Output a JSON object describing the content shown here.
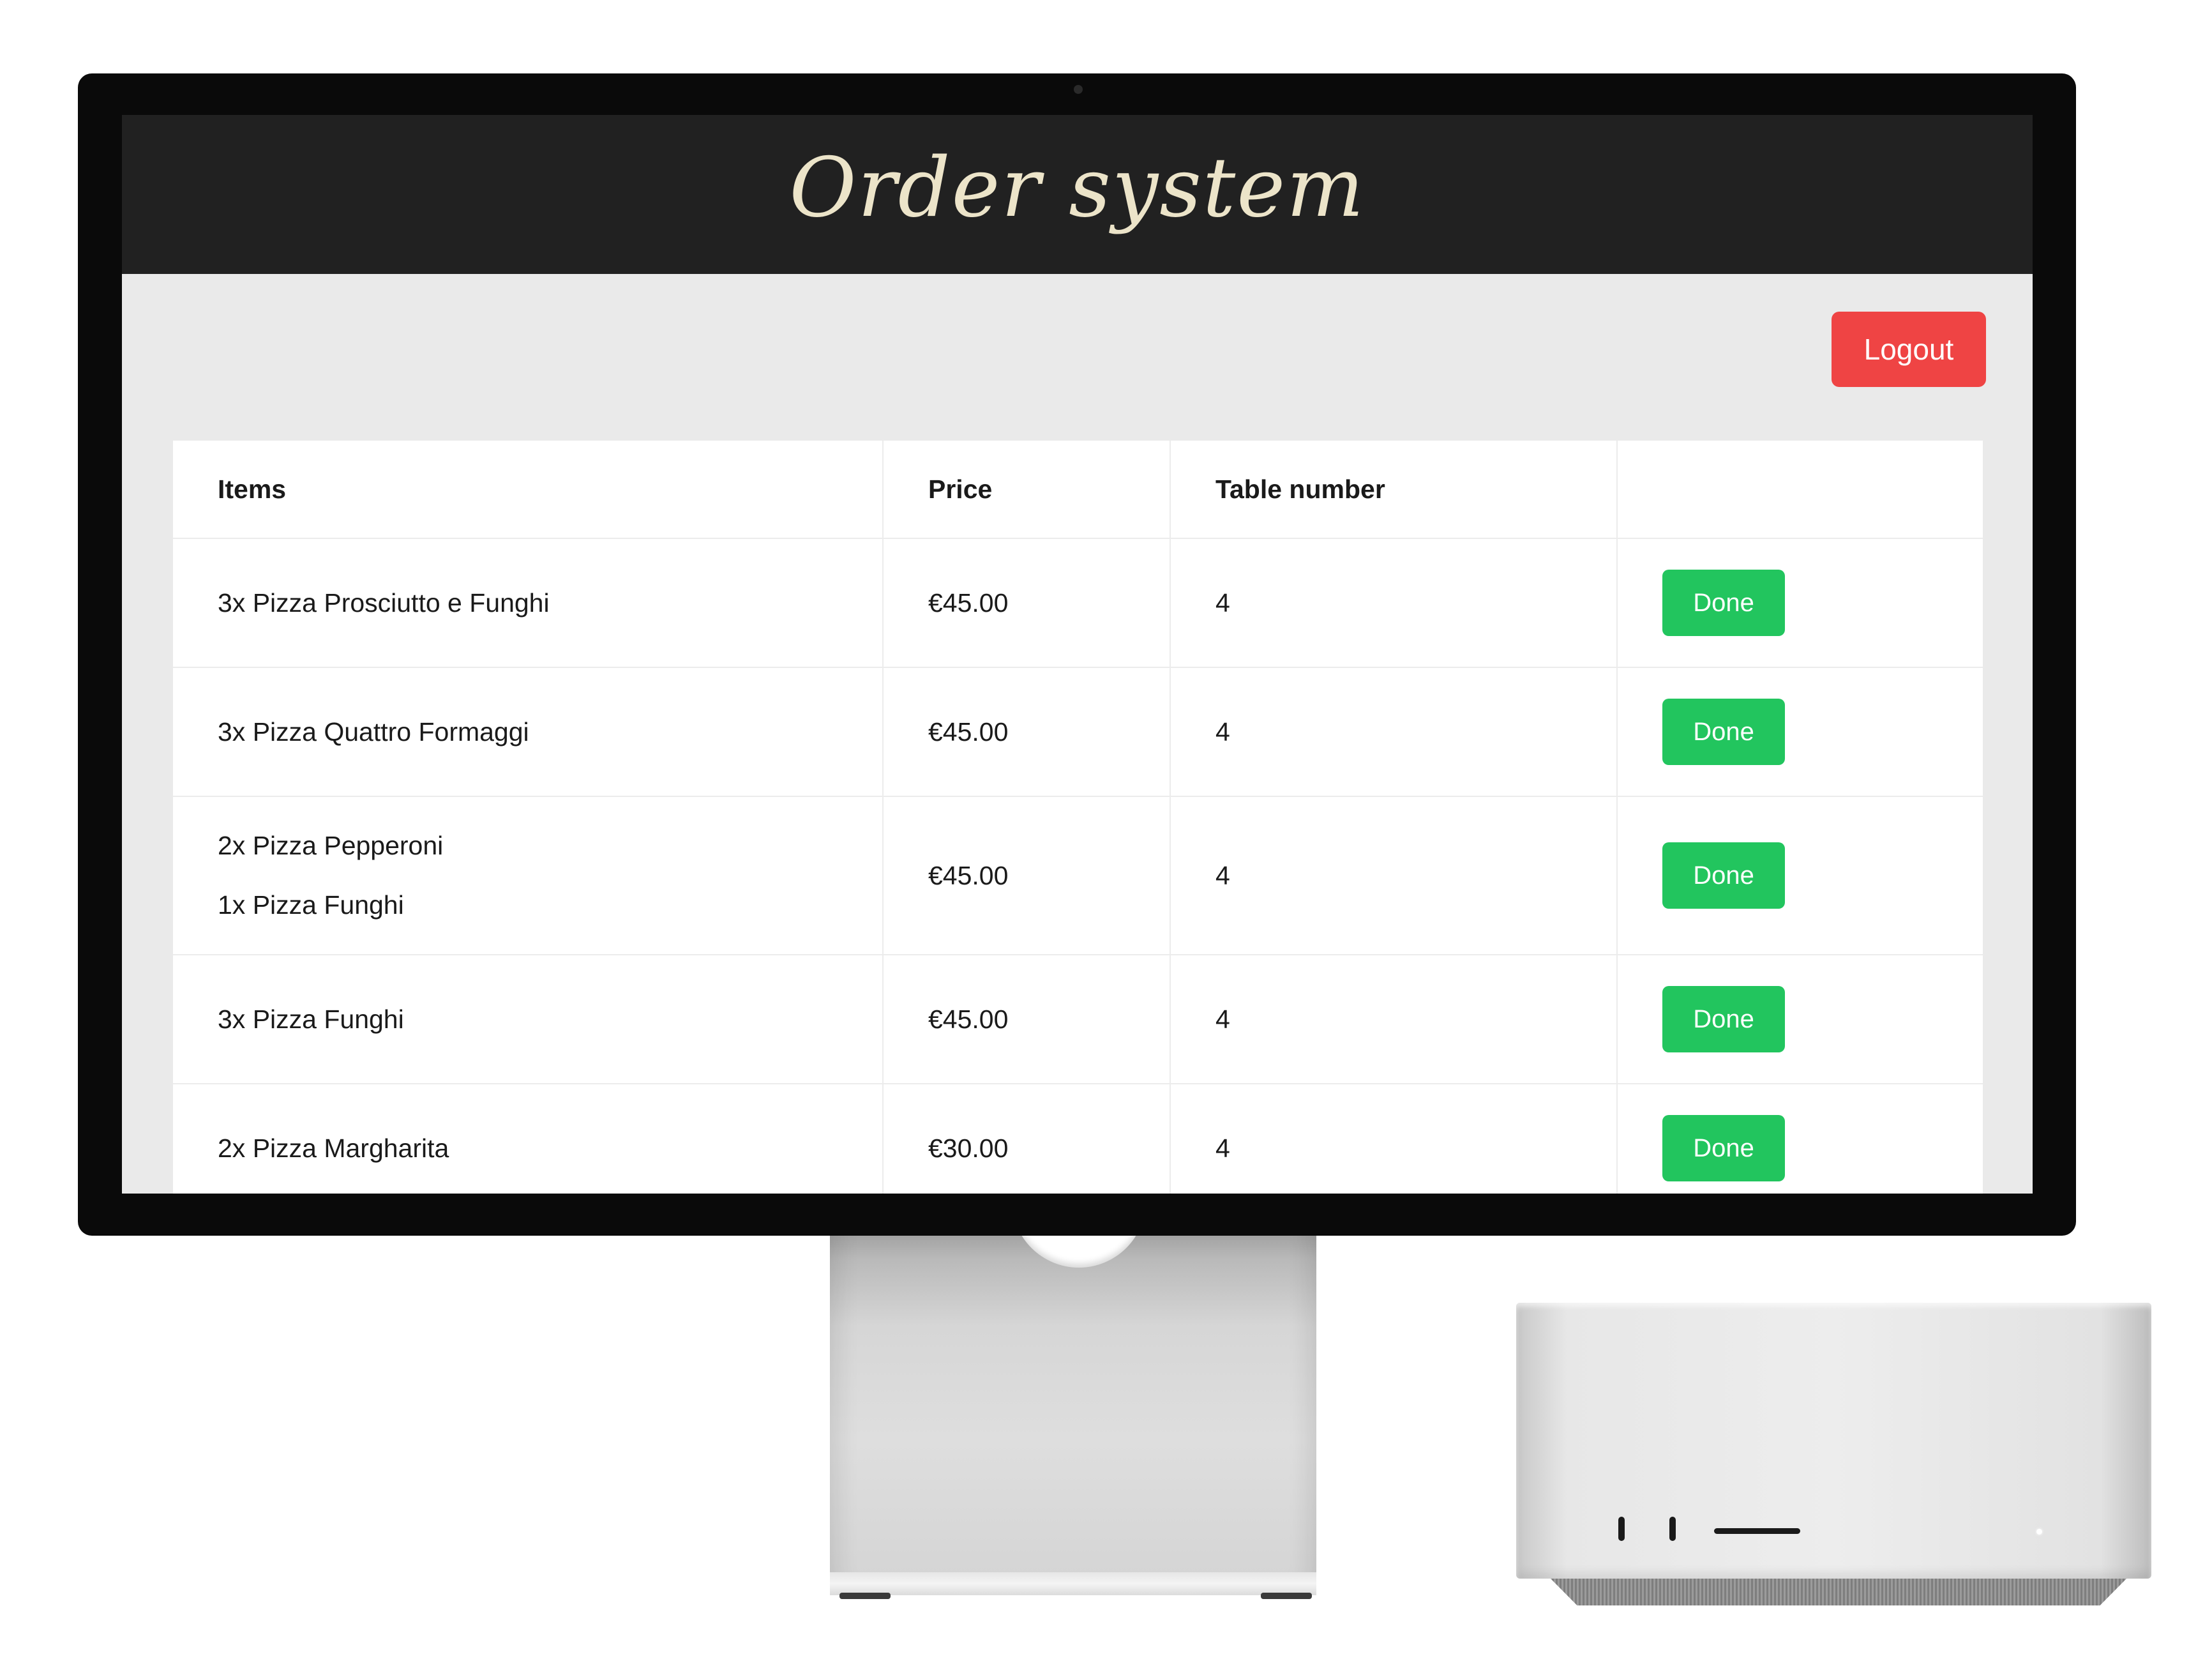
{
  "header": {
    "title": "Order system"
  },
  "toolbar": {
    "logout_label": "Logout"
  },
  "table": {
    "columns": [
      "Items",
      "Price",
      "Table number",
      ""
    ],
    "rows": [
      {
        "items": [
          "3x Pizza Prosciutto e Funghi"
        ],
        "price": "€45.00",
        "table_number": "4",
        "action": "Done"
      },
      {
        "items": [
          "3x Pizza Quattro Formaggi"
        ],
        "price": "€45.00",
        "table_number": "4",
        "action": "Done"
      },
      {
        "items": [
          "2x Pizza Pepperoni",
          "1x Pizza Funghi"
        ],
        "price": "€45.00",
        "table_number": "4",
        "action": "Done"
      },
      {
        "items": [
          "3x Pizza Funghi"
        ],
        "price": "€45.00",
        "table_number": "4",
        "action": "Done"
      },
      {
        "items": [
          "2x Pizza Margharita"
        ],
        "price": "€30.00",
        "table_number": "4",
        "action": "Done"
      }
    ]
  },
  "colors": {
    "header_bg": "#212121",
    "title_color": "#ece4c9",
    "logout_bg": "#ef4444",
    "done_bg": "#22c55e",
    "page_bg": "#eaeaea"
  },
  "icons": {
    "camera": "camera-icon",
    "power_led": "power-led-icon"
  }
}
